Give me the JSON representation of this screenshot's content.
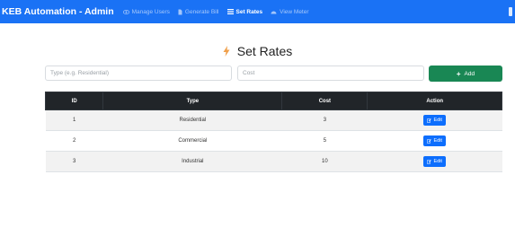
{
  "navbar": {
    "brand": "KEB Automation - Admin",
    "items": [
      {
        "label": "Manage Users",
        "icon": "eye-icon",
        "active": false
      },
      {
        "label": "Generate Bill",
        "icon": "file-icon",
        "active": false
      },
      {
        "label": "Set Rates",
        "icon": "list-icon",
        "active": true
      },
      {
        "label": "View Meter",
        "icon": "meter-icon",
        "active": false
      }
    ]
  },
  "page": {
    "title": "Set Rates",
    "title_icon": "lightning-icon",
    "title_icon_color": "#f0a04b"
  },
  "form": {
    "type_placeholder": "Type (e.g. Residential)",
    "cost_placeholder": "Cost",
    "add_label": "Add",
    "add_color": "#198754"
  },
  "table": {
    "headers": [
      "ID",
      "Type",
      "Cost",
      "Action"
    ],
    "rows": [
      {
        "id": "1",
        "type": "Residential",
        "cost": "3",
        "action": "Edit"
      },
      {
        "id": "2",
        "type": "Commercial",
        "cost": "5",
        "action": "Edit"
      },
      {
        "id": "3",
        "type": "Industrial",
        "cost": "10",
        "action": "Edit"
      }
    ]
  },
  "colors": {
    "navbar": "#1a72f5",
    "table_header": "#212529",
    "edit_button": "#0d6efd"
  }
}
